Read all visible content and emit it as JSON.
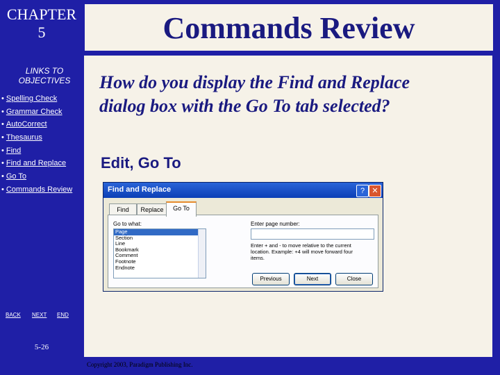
{
  "sidebar": {
    "chapter_line1": "CHAPTER",
    "chapter_line2": "5",
    "links_title_line1": "LINKS TO",
    "links_title_line2": "OBJECTIVES",
    "links": [
      {
        "label": "Spelling Check"
      },
      {
        "label": "Grammar Check"
      },
      {
        "label": "AutoCorrect"
      },
      {
        "label": "Thesaurus"
      },
      {
        "label": "Find"
      },
      {
        "label": "Find and Replace"
      },
      {
        "label": "Go To"
      },
      {
        "label": "Commands Review"
      }
    ],
    "bullet": "•",
    "controls": {
      "back": "BACK",
      "next": "NEXT",
      "end": "END"
    },
    "page_number": "5-26"
  },
  "slide": {
    "title": "Commands Review",
    "question_line1": "How do you display the Find and Replace",
    "question_line2": "dialog box with the Go To tab selected?",
    "answer": "Edit, Go To",
    "copyright": "Copyright 2003, Paradigm Publishing Inc."
  },
  "dialog": {
    "title": "Find and Replace",
    "help_glyph": "?",
    "close_glyph": "✕",
    "tabs": [
      "Find",
      "Replace",
      "Go To"
    ],
    "active_tab": "Go To",
    "goto_what_label": "Go to what:",
    "goto_items": [
      "Page",
      "Section",
      "Line",
      "Bookmark",
      "Comment",
      "Footnote",
      "Endnote"
    ],
    "selected_item": "Page",
    "page_number_label": "Enter page number:",
    "page_number_value": "",
    "hint_line1": "Enter + and - to move relative to the current",
    "hint_line2": "location. Example: +4 will move forward four",
    "hint_line3": "items.",
    "buttons": {
      "previous": "Previous",
      "next": "Next",
      "close": "Close"
    }
  },
  "colors": {
    "background": "#1f1fa6",
    "panel": "#f6f2e8",
    "title_text": "#1a1a80",
    "dialog_title_bar": "#0c3fb6",
    "dialog_face": "#ece9d8"
  }
}
